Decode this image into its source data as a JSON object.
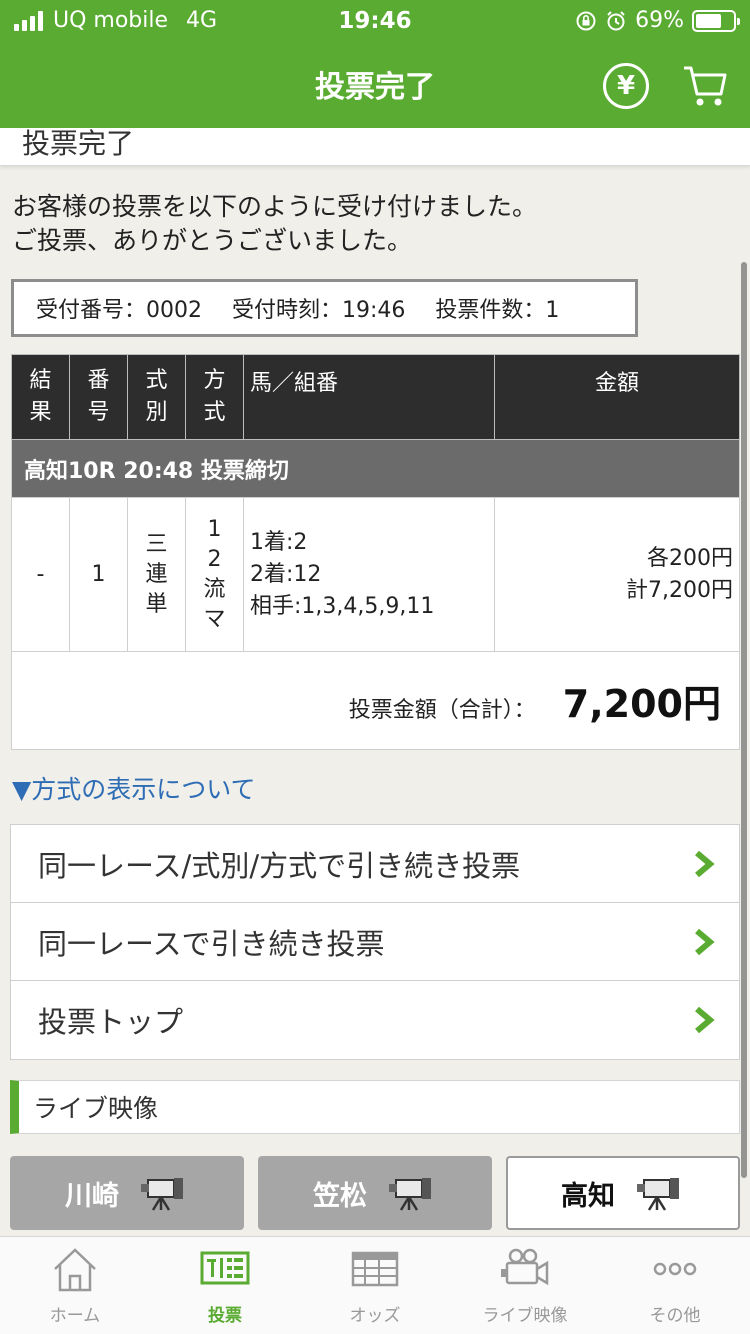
{
  "status_bar": {
    "carrier": "UQ mobile",
    "network": "4G",
    "time": "19:46",
    "battery": "69%",
    "battery_level": 0.69
  },
  "nav": {
    "title": "投票完了",
    "yen_symbol": "¥"
  },
  "section": {
    "title": "投票完了"
  },
  "message": {
    "line1": "お客様の投票を以下のように受け付けました。",
    "line2": "ご投票、ありがとうございました。"
  },
  "receipt": {
    "number": "受付番号：0002",
    "time": "受付時刻：19:46",
    "count": "投票件数：1"
  },
  "table": {
    "headers": {
      "result": [
        "結",
        "果"
      ],
      "num": [
        "番",
        "号"
      ],
      "type": [
        "式",
        "別"
      ],
      "method": [
        "方",
        "式"
      ],
      "horse": "馬／組番",
      "amount": "金額"
    },
    "race": "高知10R 20:48 投票締切",
    "row": {
      "result": "-",
      "num": "1",
      "type": [
        "三",
        "連",
        "単"
      ],
      "method": [
        "1",
        "2",
        "流",
        "マ"
      ],
      "horses": [
        "1着:2",
        "2着:12",
        "相手:1,3,4,5,9,11"
      ],
      "amounts": [
        "各200円",
        "計7,200円"
      ]
    },
    "total_label": "投票金額（合計）：",
    "total_value": "7,200円"
  },
  "about_link": "▼方式の表示について",
  "menu": [
    {
      "label": "同一レース/式別/方式で引き続き投票"
    },
    {
      "label": "同一レースで引き続き投票"
    },
    {
      "label": "投票トップ"
    }
  ],
  "live": {
    "title": "ライブ映像",
    "venues": [
      {
        "name": "川崎",
        "state": "inactive"
      },
      {
        "name": "笠松",
        "state": "inactive"
      },
      {
        "name": "高知",
        "state": "active"
      }
    ]
  },
  "tabs": [
    {
      "label": "ホーム",
      "icon": "home-icon"
    },
    {
      "label": "投票",
      "icon": "vote-icon",
      "active": true
    },
    {
      "label": "オッズ",
      "icon": "odds-icon"
    },
    {
      "label": "ライブ映像",
      "icon": "video-camera-icon"
    },
    {
      "label": "その他",
      "icon": "more-icon"
    }
  ],
  "colors": {
    "brand_green": "#5aab31",
    "link_blue": "#2e6db5",
    "header_dark": "#2d2d2d"
  }
}
